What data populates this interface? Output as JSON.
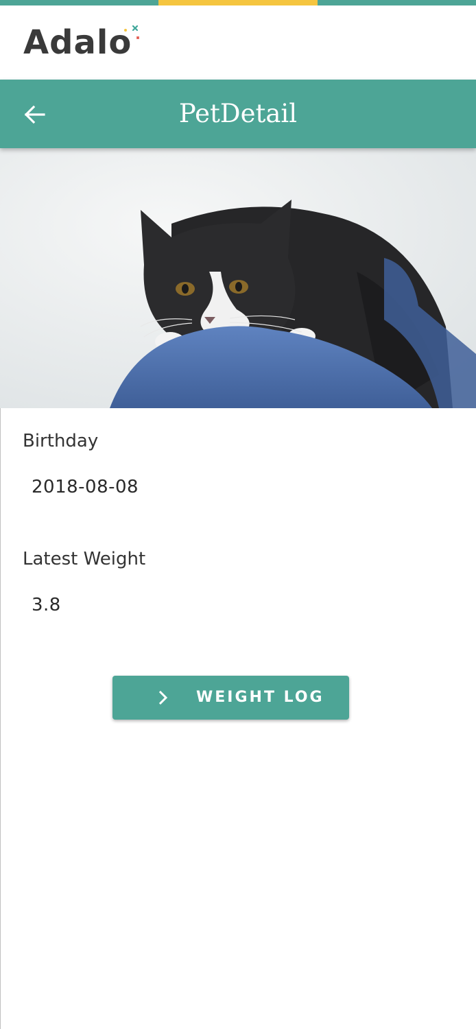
{
  "colors": {
    "primary": "#4da596",
    "top_strip": [
      "#4da596",
      "#f5c540",
      "#4da596"
    ],
    "logo_gray": "#3a3a3a",
    "label_text": "#333333"
  },
  "brand": {
    "logo_text": "Adalo",
    "logo_icon": "sparkle-icon"
  },
  "appbar": {
    "title": "PetDetail",
    "back_icon": "arrow-left-icon"
  },
  "hero": {
    "image_subject": "cat-photo"
  },
  "details": {
    "birthday_label": "Birthday",
    "birthday_value": "2018-08-08",
    "weight_label": "Latest Weight",
    "weight_value": "3.8"
  },
  "action": {
    "button_label": "WEIGHT LOG",
    "button_icon": "chevron-right-icon"
  }
}
